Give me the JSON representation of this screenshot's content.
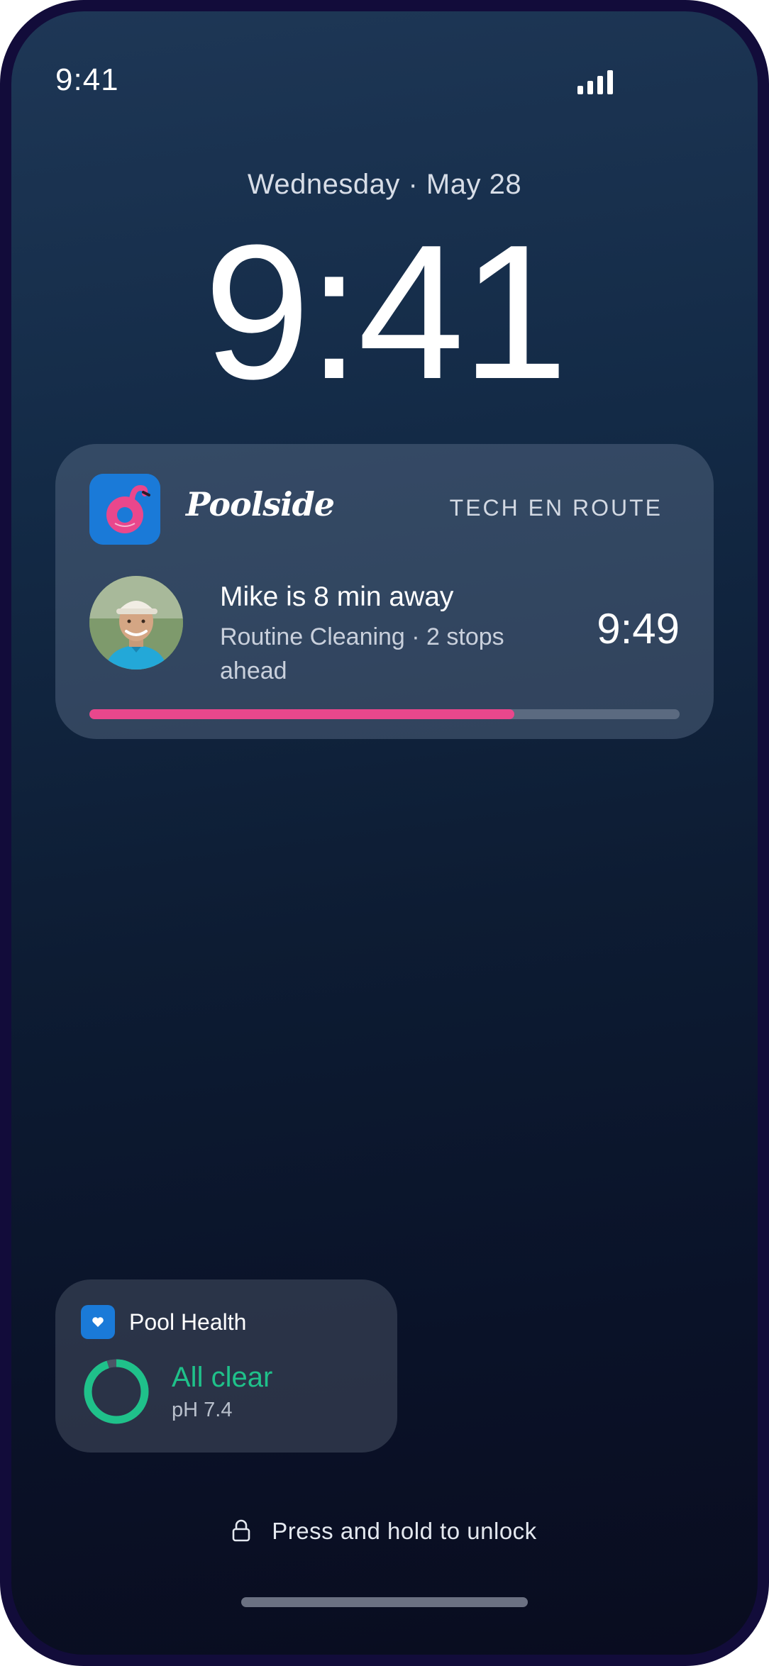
{
  "status_bar": {
    "time": "9:41",
    "signal_icon": "signal-bars-icon"
  },
  "lock_screen": {
    "date": "Wednesday · May 28",
    "time": "9:41"
  },
  "live_activity": {
    "app_icon": "flamingo-float-icon",
    "app_name": "Poolside",
    "status_label": "TECH EN ROUTE",
    "tech_title": "Mike is 8 min away",
    "tech_subtitle": "Routine Cleaning · 2 stops ahead",
    "eta": "9:49",
    "progress": 0.72,
    "progress_color": "#e9478c"
  },
  "widget": {
    "icon": "heart-icon",
    "title": "Pool Health",
    "status": "All clear",
    "detail": "pH 7.4",
    "status_color": "#1fc18a",
    "ring_fraction": 0.95
  },
  "unlock_hint": {
    "icon": "lock-icon",
    "text": "Press and hold to unlock"
  }
}
